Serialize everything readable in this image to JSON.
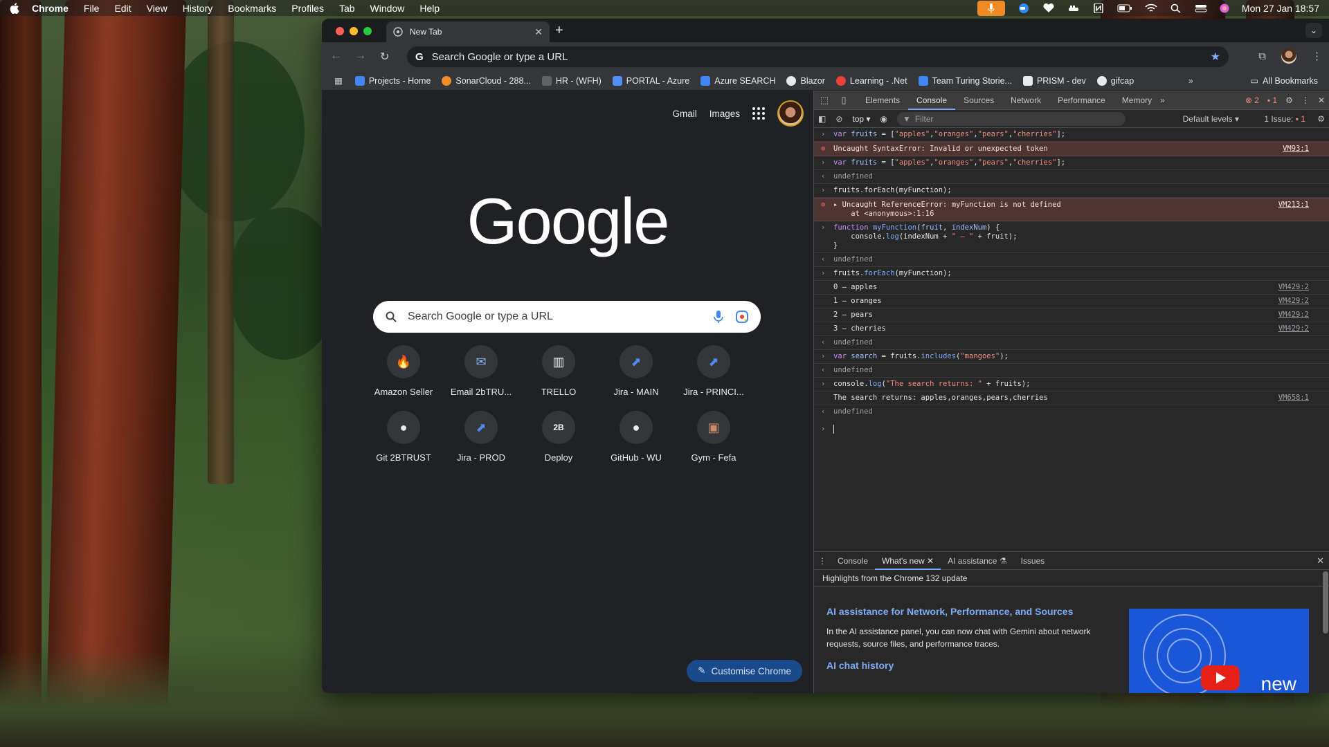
{
  "menubar": {
    "app": "Chrome",
    "items": [
      "File",
      "Edit",
      "View",
      "History",
      "Bookmarks",
      "Profiles",
      "Tab",
      "Window",
      "Help"
    ],
    "clock": "Mon 27 Jan  18:57"
  },
  "browser": {
    "tab_title": "New Tab",
    "omnibox_text": "Search Google or type a URL",
    "bookmarks": [
      {
        "label": "Projects - Home",
        "color": "#4285f4"
      },
      {
        "label": "SonarCloud - 288...",
        "color": "#f28b2c"
      },
      {
        "label": "HR - (WFH)",
        "color": "#5f6368"
      },
      {
        "label": "PORTAL - Azure",
        "color": "#4f8ff7"
      },
      {
        "label": "Azure SEARCH",
        "color": "#4285f4"
      },
      {
        "label": "Blazor",
        "color": "#e8eaed"
      },
      {
        "label": "Learning - .Net",
        "color": "#ea4335"
      },
      {
        "label": "Team Turing Storie...",
        "color": "#4285f4"
      },
      {
        "label": "PRISM - dev",
        "color": "#e8eaed"
      },
      {
        "label": "gifcap",
        "color": "#e8eaed"
      }
    ],
    "all_bookmarks": "All Bookmarks"
  },
  "ntp": {
    "gmail": "Gmail",
    "images": "Images",
    "logo": "Google",
    "search_placeholder": "Search Google or type a URL",
    "shortcuts": [
      {
        "label": "Amazon Seller",
        "icon": "flame-icon",
        "glyph": "🔥"
      },
      {
        "label": "Email 2bTRU...",
        "icon": "mail-icon",
        "glyph": "✉"
      },
      {
        "label": "TRELLO",
        "icon": "trello-icon",
        "glyph": "▥"
      },
      {
        "label": "Jira - MAIN",
        "icon": "jira-icon",
        "glyph": "⬈"
      },
      {
        "label": "Jira - PRINCI...",
        "icon": "jira-icon",
        "glyph": "⬈"
      },
      {
        "label": "Git 2BTRUST",
        "icon": "github-icon",
        "glyph": "●"
      },
      {
        "label": "Jira - PROD",
        "icon": "jira-icon",
        "glyph": "⬈"
      },
      {
        "label": "Deploy",
        "icon": "deploy-icon",
        "glyph": "2B"
      },
      {
        "label": "GitHub - WU",
        "icon": "github-icon",
        "glyph": "●"
      },
      {
        "label": "Gym - Fefa",
        "icon": "gym-icon",
        "glyph": "▣"
      }
    ],
    "customise": "Customise Chrome"
  },
  "devtools": {
    "tabs": [
      "Elements",
      "Console",
      "Sources",
      "Network",
      "Performance",
      "Memory"
    ],
    "active_tab": "Console",
    "error_count": "2",
    "warning_count": "1",
    "context": "top",
    "filter_placeholder": "Filter",
    "levels": "Default levels",
    "issues_label": "1 Issue:",
    "issues_count": "1",
    "drawer_tabs": [
      "Console",
      "What's new",
      "AI assistance",
      "Issues"
    ],
    "drawer_heading": "Highlights from the Chrome 132 update",
    "whats_new_title": "AI assistance for Network, Performance, and Sources",
    "whats_new_body": "In the AI assistance panel, you can now chat with Gemini about network requests, source files, and performance traces.",
    "whats_new_subtitle": "AI chat history",
    "thumb_text": "new"
  },
  "console": {
    "src_93": "VM93:1",
    "err1": "Uncaught SyntaxError: Invalid or unexpected token",
    "undefined": "undefined",
    "call_foreach": "fruits.forEach(myFunction);",
    "src_213": "VM213:1",
    "err2a": "Uncaught ReferenceError: myFunction is not defined",
    "err2b": "    at <anonymous>:1:16",
    "fn_close": "}",
    "log0": "0 – apples",
    "log1": "1 – oranges",
    "log2": "2 – pears",
    "log3": "3 – cherries",
    "src_429": "VM429:2",
    "search_out": "The search returns: apples,oranges,pears,cherries",
    "src_658": "VM658:1"
  }
}
